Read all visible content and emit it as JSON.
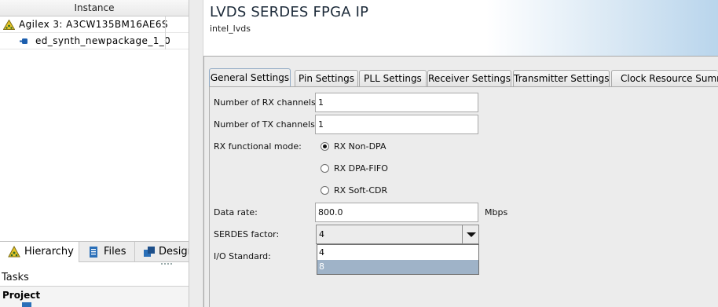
{
  "left_panel": {
    "instance_header": "Instance",
    "tree": [
      {
        "label": "Agilex 3: A3CW135BM16AE6S"
      },
      {
        "label": "ed_synth_newpackage_1_0"
      }
    ],
    "tabs": [
      {
        "label": "Hierarchy",
        "icon": "hierarchy-icon",
        "active": true
      },
      {
        "label": "Files",
        "icon": "files-icon",
        "active": false
      },
      {
        "label": "Design",
        "icon": "design-units-icon",
        "active": false
      }
    ],
    "tasks_label": "Tasks",
    "project_label": "Project"
  },
  "ip": {
    "title": "LVDS SERDES FPGA IP",
    "subtitle": "intel_lvds"
  },
  "tabs": [
    {
      "label": "General Settings",
      "active": true
    },
    {
      "label": "Pin Settings",
      "active": false
    },
    {
      "label": "PLL Settings",
      "active": false
    },
    {
      "label": "Receiver Settings",
      "active": false
    },
    {
      "label": "Transmitter Settings",
      "active": false
    },
    {
      "label": "Clock Resource Summary",
      "active": false
    }
  ],
  "form": {
    "rx_channels": {
      "label": "Number of RX channels:",
      "value": "1"
    },
    "tx_channels": {
      "label": "Number of TX channels:",
      "value": "1"
    },
    "rx_mode": {
      "label": "RX functional mode:",
      "options": [
        "RX Non-DPA",
        "RX DPA-FIFO",
        "RX Soft-CDR"
      ],
      "selected": "RX Non-DPA"
    },
    "data_rate": {
      "label": "Data rate:",
      "value": "800.0",
      "units": "Mbps"
    },
    "serdes_factor": {
      "label": "SERDES factor:",
      "value": "4",
      "options": [
        "4",
        "8"
      ],
      "highlighted": "8"
    },
    "io_standard": {
      "label": "I/O Standard:"
    }
  },
  "colors": {
    "accent_blue": "#2a6fb8",
    "dropdown_highlight": "#9fb3c8",
    "title_gradient_end": "#b9d5ec"
  }
}
